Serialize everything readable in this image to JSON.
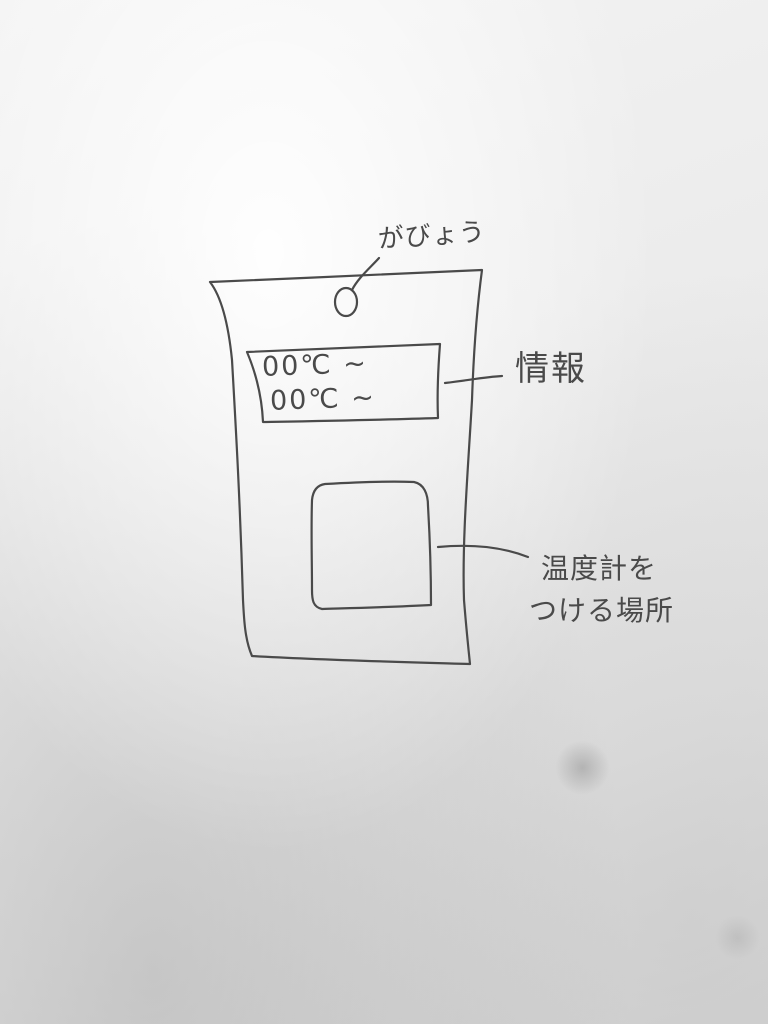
{
  "labels": {
    "hook": "がびょう",
    "info": "情報",
    "thermometer_line1": "温度計を",
    "thermometer_line2": "つける場所"
  },
  "info_panel": {
    "line1": "00℃ ~",
    "line2": "00℃ ~"
  },
  "colors": {
    "ink": "#4a4a4a",
    "paper": "#ececec"
  }
}
